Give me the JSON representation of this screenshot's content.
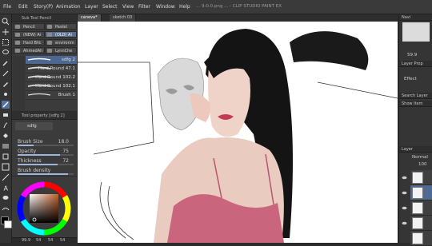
{
  "menubar": {
    "items": [
      "File",
      "Edit",
      "Story(P)",
      "Animation",
      "Layer",
      "Select",
      "View",
      "Filter",
      "Window",
      "Help"
    ],
    "title": "... 9:0.0.png ... - CLIP STUDIO PAINT EX"
  },
  "subtool": {
    "header": "Sub Tool Pencil",
    "sets": [
      "Pencil",
      "Pastel",
      "(NEW) Ai",
      "(OLD) Ai",
      "Hard Blic",
      "environm",
      "AhmedAli",
      "LynnChe"
    ],
    "brushes": [
      {
        "label": "sdfg 2",
        "selected": true
      },
      {
        "label": "Hard Round 47.1",
        "selected": false
      },
      {
        "label": "Hard Round 102.2",
        "selected": false
      },
      {
        "label": "Hard Round 102.1",
        "selected": false
      },
      {
        "label": "Brush 1",
        "selected": false
      }
    ]
  },
  "toolprop": {
    "header": "Tool property [sdfg 2]",
    "name": "sdfg",
    "rows": [
      {
        "name": "Brush Size",
        "value": "18.0",
        "fraction": 0.28
      },
      {
        "name": "Opacity",
        "value": "75",
        "fraction": 0.75
      },
      {
        "name": "Thickness",
        "value": "72",
        "fraction": 0.72
      },
      {
        "name": "Brush density",
        "value": "",
        "fraction": 0.9
      }
    ]
  },
  "status": {
    "zoom": "99.9",
    "size_a": "54",
    "size_b": "54",
    "size_c": "54"
  },
  "doctabs": [
    "caneva*",
    "sketch 03"
  ],
  "right": {
    "zoom_value": "59.9",
    "effect_label": "Effect",
    "layer_label": "Layer",
    "blend_label": "Normal",
    "opacity_value": "100",
    "tabs": [
      "Navi",
      "Layer Prop",
      "Search Layer",
      "Show Item",
      "Layer",
      "Layer"
    ]
  },
  "colors": {
    "hue_indicator": "#b97a55",
    "main": "#000000",
    "sub": "#ffffff"
  }
}
